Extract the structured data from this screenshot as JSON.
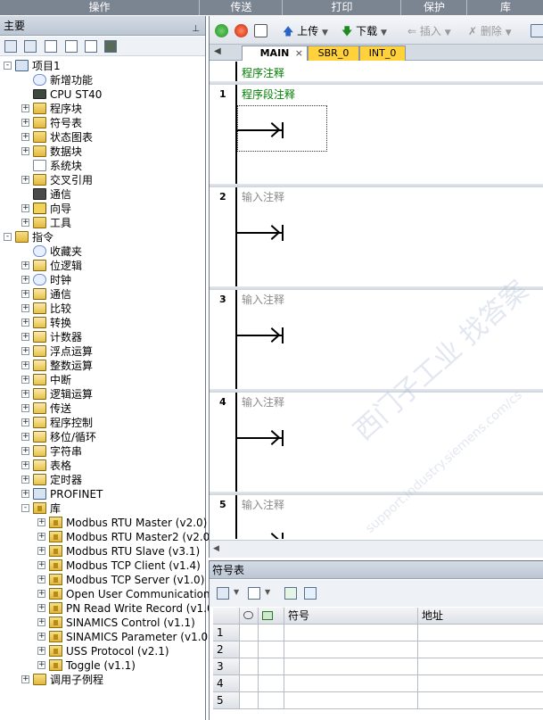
{
  "ribbon": {
    "groups": [
      "操作",
      "传送",
      "打印",
      "保护",
      "库"
    ]
  },
  "left_panel": {
    "title": "主要",
    "tree": [
      {
        "label": "项目1",
        "level": 0,
        "expander": "-",
        "icon": "project-icon"
      },
      {
        "label": "新增功能",
        "level": 1,
        "expander": "",
        "icon": "help-icon"
      },
      {
        "label": "CPU ST40",
        "level": 1,
        "expander": "",
        "icon": "cpu-icon"
      },
      {
        "label": "程序块",
        "level": 1,
        "expander": "+",
        "icon": "folder-icon"
      },
      {
        "label": "符号表",
        "level": 1,
        "expander": "+",
        "icon": "folder-icon"
      },
      {
        "label": "状态图表",
        "level": 1,
        "expander": "+",
        "icon": "folder-icon"
      },
      {
        "label": "数据块",
        "level": 1,
        "expander": "+",
        "icon": "folder-icon"
      },
      {
        "label": "系统块",
        "level": 1,
        "expander": "",
        "icon": "document-icon"
      },
      {
        "label": "交叉引用",
        "level": 1,
        "expander": "+",
        "icon": "folder-icon"
      },
      {
        "label": "通信",
        "level": 1,
        "expander": "",
        "icon": "monitor-icon"
      },
      {
        "label": "向导",
        "level": 1,
        "expander": "+",
        "icon": "wizard-icon"
      },
      {
        "label": "工具",
        "level": 1,
        "expander": "+",
        "icon": "folder-icon"
      },
      {
        "label": "指令",
        "level": 0,
        "expander": "-",
        "icon": "instruction-folder-icon"
      },
      {
        "label": "收藏夹",
        "level": 1,
        "expander": "",
        "icon": "favorites-icon"
      },
      {
        "label": "位逻辑",
        "level": 1,
        "expander": "+",
        "icon": "instruction-group-icon"
      },
      {
        "label": "时钟",
        "level": 1,
        "expander": "+",
        "icon": "clock-icon"
      },
      {
        "label": "通信",
        "level": 1,
        "expander": "+",
        "icon": "instruction-group-icon"
      },
      {
        "label": "比较",
        "level": 1,
        "expander": "+",
        "icon": "instruction-group-icon"
      },
      {
        "label": "转换",
        "level": 1,
        "expander": "+",
        "icon": "instruction-group-icon"
      },
      {
        "label": "计数器",
        "level": 1,
        "expander": "+",
        "icon": "instruction-group-icon"
      },
      {
        "label": "浮点运算",
        "level": 1,
        "expander": "+",
        "icon": "instruction-group-icon"
      },
      {
        "label": "整数运算",
        "level": 1,
        "expander": "+",
        "icon": "instruction-group-icon"
      },
      {
        "label": "中断",
        "level": 1,
        "expander": "+",
        "icon": "instruction-group-icon"
      },
      {
        "label": "逻辑运算",
        "level": 1,
        "expander": "+",
        "icon": "instruction-group-icon"
      },
      {
        "label": "传送",
        "level": 1,
        "expander": "+",
        "icon": "instruction-group-icon"
      },
      {
        "label": "程序控制",
        "level": 1,
        "expander": "+",
        "icon": "instruction-group-icon"
      },
      {
        "label": "移位/循环",
        "level": 1,
        "expander": "+",
        "icon": "instruction-group-icon"
      },
      {
        "label": "字符串",
        "level": 1,
        "expander": "+",
        "icon": "instruction-group-icon"
      },
      {
        "label": "表格",
        "level": 1,
        "expander": "+",
        "icon": "instruction-group-icon"
      },
      {
        "label": "定时器",
        "level": 1,
        "expander": "+",
        "icon": "instruction-group-icon"
      },
      {
        "label": "PROFINET",
        "level": 1,
        "expander": "+",
        "icon": "network-icon"
      },
      {
        "label": "库",
        "level": 1,
        "expander": "-",
        "icon": "library-icon"
      },
      {
        "label": "Modbus RTU Master (v2.0)",
        "level": 2,
        "expander": "+",
        "icon": "library-icon"
      },
      {
        "label": "Modbus RTU Master2 (v2.0)",
        "level": 2,
        "expander": "+",
        "icon": "library-icon"
      },
      {
        "label": "Modbus RTU Slave (v3.1)",
        "level": 2,
        "expander": "+",
        "icon": "library-icon"
      },
      {
        "label": "Modbus TCP Client (v1.4)",
        "level": 2,
        "expander": "+",
        "icon": "library-icon"
      },
      {
        "label": "Modbus TCP Server (v1.0)",
        "level": 2,
        "expander": "+",
        "icon": "library-icon"
      },
      {
        "label": "Open User Communication (v1.0)",
        "level": 2,
        "expander": "+",
        "icon": "library-icon"
      },
      {
        "label": "PN Read Write Record (v1.0)",
        "level": 2,
        "expander": "+",
        "icon": "library-icon"
      },
      {
        "label": "SINAMICS Control (v1.1)",
        "level": 2,
        "expander": "+",
        "icon": "library-icon"
      },
      {
        "label": "SINAMICS Parameter (v1.0)",
        "level": 2,
        "expander": "+",
        "icon": "library-icon"
      },
      {
        "label": "USS Protocol (v2.1)",
        "level": 2,
        "expander": "+",
        "icon": "library-icon"
      },
      {
        "label": "Toggle (v1.1)",
        "level": 2,
        "expander": "+",
        "icon": "library-icon"
      },
      {
        "label": "调用子例程",
        "level": 1,
        "expander": "+",
        "icon": "folder-icon"
      }
    ]
  },
  "editor": {
    "toolbar": {
      "upload": "上传",
      "download": "下载",
      "insert": "插入",
      "delete": "删除"
    },
    "tabs": [
      {
        "label": "MAIN",
        "active": true
      },
      {
        "label": "SBR_0",
        "active": false
      },
      {
        "label": "INT_0",
        "active": false
      }
    ],
    "program_comment": "程序注释",
    "rungs": [
      {
        "number": "1",
        "comment": "程序段注释"
      },
      {
        "number": "2",
        "comment": "输入注释"
      },
      {
        "number": "3",
        "comment": "输入注释"
      },
      {
        "number": "4",
        "comment": "输入注释"
      },
      {
        "number": "5",
        "comment": "输入注释"
      }
    ],
    "watermark": "西门子工业 找答案",
    "watermark_url": "support.industry.siemens.com/cs"
  },
  "symbol_table": {
    "title": "符号表",
    "columns": [
      "",
      "",
      "",
      "符号",
      "地址"
    ],
    "rows": [
      "1",
      "2",
      "3",
      "4",
      "5"
    ]
  },
  "colors": {
    "accent": "#ffd23c",
    "green_comment": "#008000",
    "panel_header": "#c5cedb"
  }
}
